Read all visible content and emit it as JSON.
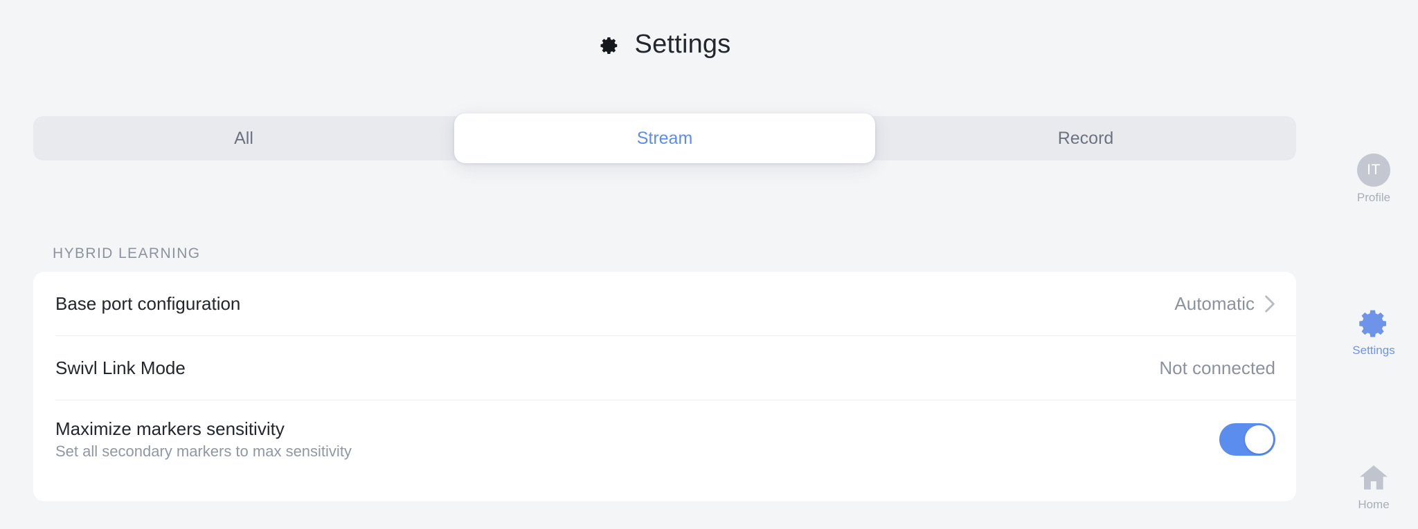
{
  "header": {
    "title": "Settings",
    "icon": "gear-icon"
  },
  "segmented_control": {
    "options": [
      {
        "label": "All",
        "active": false
      },
      {
        "label": "Stream",
        "active": true
      },
      {
        "label": "Record",
        "active": false
      }
    ],
    "selected": "Stream",
    "active_text_color": "#5b8def",
    "inactive_text_color": "#6c7380",
    "track_color": "#e8eaee"
  },
  "section": {
    "header": "HYBRID LEARNING",
    "rows": [
      {
        "title": "Base port configuration",
        "subtitle": "",
        "value": "Automatic",
        "control": "chevron",
        "chevron_icon": "chevron-right-icon"
      },
      {
        "title": "Swivl Link Mode",
        "subtitle": "",
        "value": "Not connected",
        "control": "text"
      },
      {
        "title": "Maximize markers sensitivity",
        "subtitle": "Set all secondary markers to max sensitivity",
        "value": "",
        "control": "toggle",
        "toggle_on": true,
        "toggle_color": "#5b8def"
      }
    ]
  },
  "rail": {
    "items": [
      {
        "label": "Profile",
        "icon": "avatar",
        "initials": "IT",
        "active": false
      },
      {
        "label": "Settings",
        "icon": "gear-icon",
        "active": true
      },
      {
        "label": "Home",
        "icon": "home-icon",
        "active": false
      }
    ]
  },
  "colors": {
    "page_background": "#f4f5f7",
    "card_background": "#ffffff",
    "accent": "#5b8def",
    "muted_text": "#8c929d",
    "primary_text": "#23262c"
  }
}
